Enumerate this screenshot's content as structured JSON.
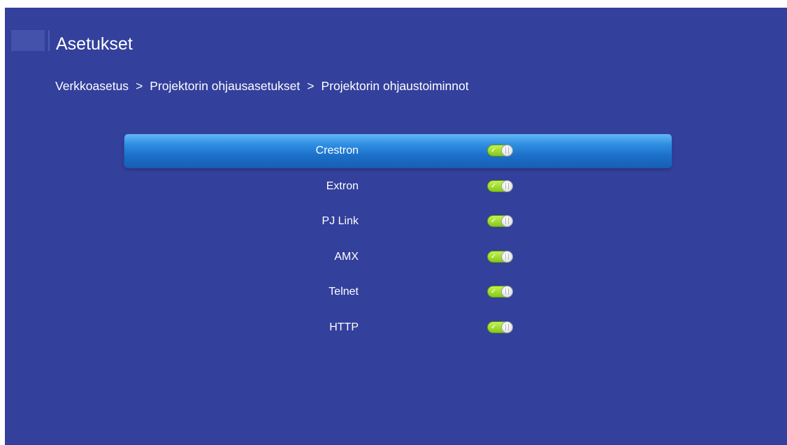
{
  "header": {
    "title": "Asetukset"
  },
  "breadcrumb": {
    "items": [
      "Verkkoasetus",
      "Projektorin ohjausasetukset",
      "Projektorin ohjaustoiminnot"
    ],
    "separator": ">"
  },
  "options": [
    {
      "label": "Crestron",
      "enabled": true,
      "selected": true
    },
    {
      "label": "Extron",
      "enabled": true,
      "selected": false
    },
    {
      "label": "PJ Link",
      "enabled": true,
      "selected": false
    },
    {
      "label": "AMX",
      "enabled": true,
      "selected": false
    },
    {
      "label": "Telnet",
      "enabled": true,
      "selected": false
    },
    {
      "label": "HTTP",
      "enabled": true,
      "selected": false
    }
  ],
  "icons": {
    "toggle_check": "✓"
  },
  "colors": {
    "background": "#33409c",
    "selection": "#1f78d0",
    "toggle_on": "#a6df34"
  }
}
